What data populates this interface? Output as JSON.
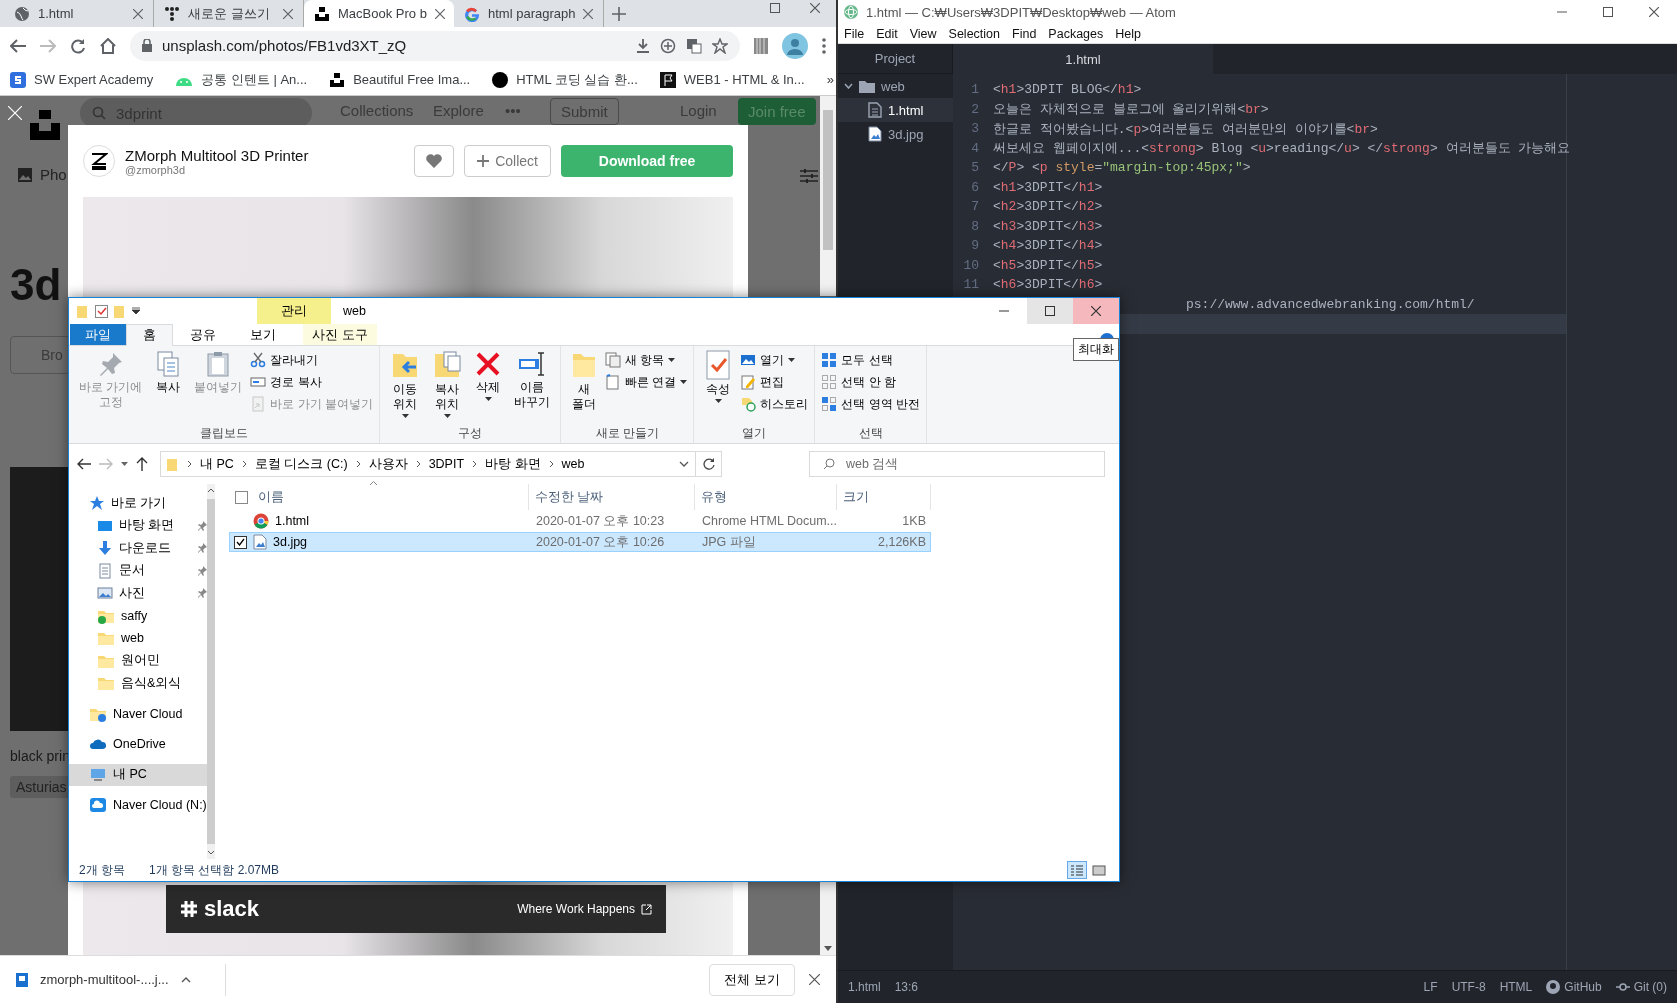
{
  "browser": {
    "tabs": [
      {
        "title": "1.html",
        "selected": false
      },
      {
        "title": "새로운 글쓰기",
        "selected": false
      },
      {
        "title": "MacBook Pro b",
        "selected": true
      },
      {
        "title": "html paragraph",
        "selected": false
      }
    ],
    "url": "unsplash.com/photos/FB1vd3XT_zQ",
    "bookmarks": [
      "SW Expert Academy",
      "공통 인텐트  |  An...",
      "Beautiful Free Ima...",
      "HTML 코딩 실습 환...",
      "WEB1 - HTML & In..."
    ],
    "more_bookmarks": "»",
    "page": {
      "search_value": "3dprint",
      "nav": [
        "Collections",
        "Explore",
        "•••"
      ],
      "submit": "Submit",
      "login": "Login",
      "join": "Join free",
      "tab": "Pho",
      "heading": "3d",
      "button": "Bro",
      "caption": "black prin",
      "tag": "Asturias",
      "modal": {
        "title": "ZMorph Multitool 3D Printer",
        "user": "@zmorph3d",
        "collect": "Collect",
        "download": "Download free"
      },
      "ad": {
        "brand": "slack",
        "link": "Where Work Happens"
      }
    },
    "download": {
      "file": "zmorph-multitool-....j...",
      "show_all": "전체 보기"
    }
  },
  "atom": {
    "title": "1.html — C:₩Users₩3DPIT₩Desktop₩web — Atom",
    "menu": [
      "File",
      "Edit",
      "View",
      "Selection",
      "Find",
      "Packages",
      "Help"
    ],
    "tree": {
      "header": "Project",
      "folder": {
        "name": "web",
        "expanded": true,
        "children": [
          {
            "name": "1.html",
            "selected": true
          },
          {
            "name": "3d.jpg",
            "selected": false
          }
        ]
      }
    },
    "tab": "1.html",
    "lines": [
      {
        "number": "1",
        "current": false,
        "tokens": [
          {
            "kind": "p",
            "text": "<"
          },
          {
            "kind": "tag",
            "text": "h1"
          },
          {
            "kind": "p",
            "text": ">3DPIT BLOG</"
          },
          {
            "kind": "tag",
            "text": "h1"
          },
          {
            "kind": "p",
            "text": ">"
          }
        ]
      },
      {
        "number": "2",
        "current": false,
        "tokens": [
          {
            "kind": "p",
            "text": "오늘은 자체적으로 블로그에 올리기위해<"
          },
          {
            "kind": "tag",
            "text": "br"
          },
          {
            "kind": "p",
            "text": ">"
          }
        ]
      },
      {
        "number": "3",
        "current": false,
        "tokens": [
          {
            "kind": "p",
            "text": "한글로 적어봤습니다.<"
          },
          {
            "kind": "tag",
            "text": "p"
          },
          {
            "kind": "p",
            "text": ">여러분들도 여러분만의 이야기를<"
          },
          {
            "kind": "tag",
            "text": "br"
          },
          {
            "kind": "p",
            "text": ">"
          }
        ]
      },
      {
        "number": "4",
        "current": false,
        "tokens": [
          {
            "kind": "p",
            "text": "써보세요 웹페이지에...<"
          },
          {
            "kind": "tag",
            "text": "strong"
          },
          {
            "kind": "p",
            "text": "> Blog <"
          },
          {
            "kind": "tag",
            "text": "u"
          },
          {
            "kind": "p",
            "text": ">reading</"
          },
          {
            "kind": "tag",
            "text": "u"
          },
          {
            "kind": "p",
            "text": "> </"
          },
          {
            "kind": "tag",
            "text": "strong"
          },
          {
            "kind": "p",
            "text": "> 여러분들도 가능해요"
          }
        ]
      },
      {
        "number": "5",
        "current": false,
        "tokens": [
          {
            "kind": "p",
            "text": "</"
          },
          {
            "kind": "tag",
            "text": "P"
          },
          {
            "kind": "p",
            "text": "> <"
          },
          {
            "kind": "tag",
            "text": "p"
          },
          {
            "kind": "attr",
            "text": " style"
          },
          {
            "kind": "p",
            "text": "="
          },
          {
            "kind": "str",
            "text": "\"margin-top:45px;\""
          },
          {
            "kind": "p",
            "text": ">"
          }
        ]
      },
      {
        "number": "6",
        "current": false,
        "tokens": [
          {
            "kind": "p",
            "text": "<"
          },
          {
            "kind": "tag",
            "text": "h1"
          },
          {
            "kind": "p",
            "text": ">3DPIT</"
          },
          {
            "kind": "tag",
            "text": "h1"
          },
          {
            "kind": "p",
            "text": ">"
          }
        ]
      },
      {
        "number": "7",
        "current": false,
        "tokens": [
          {
            "kind": "p",
            "text": "<"
          },
          {
            "kind": "tag",
            "text": "h2"
          },
          {
            "kind": "p",
            "text": ">3DPIT</"
          },
          {
            "kind": "tag",
            "text": "h2"
          },
          {
            "kind": "p",
            "text": ">"
          }
        ]
      },
      {
        "number": "8",
        "current": false,
        "tokens": [
          {
            "kind": "p",
            "text": "<"
          },
          {
            "kind": "tag",
            "text": "h3"
          },
          {
            "kind": "p",
            "text": ">3DPIT</"
          },
          {
            "kind": "tag",
            "text": "h3"
          },
          {
            "kind": "p",
            "text": ">"
          }
        ]
      },
      {
        "number": "9",
        "current": false,
        "tokens": [
          {
            "kind": "p",
            "text": "<"
          },
          {
            "kind": "tag",
            "text": "h4"
          },
          {
            "kind": "p",
            "text": ">3DPIT</"
          },
          {
            "kind": "tag",
            "text": "h4"
          },
          {
            "kind": "p",
            "text": ">"
          }
        ]
      },
      {
        "number": "10",
        "current": false,
        "tokens": [
          {
            "kind": "p",
            "text": "<"
          },
          {
            "kind": "tag",
            "text": "h5"
          },
          {
            "kind": "p",
            "text": ">3DPIT</"
          },
          {
            "kind": "tag",
            "text": "h5"
          },
          {
            "kind": "p",
            "text": ">"
          }
        ]
      },
      {
        "number": "11",
        "current": false,
        "tokens": [
          {
            "kind": "p",
            "text": "<"
          },
          {
            "kind": "tag",
            "text": "h6"
          },
          {
            "kind": "p",
            "text": ">3DPIT</"
          },
          {
            "kind": "tag",
            "text": "h6"
          },
          {
            "kind": "p",
            "text": ">"
          }
        ]
      },
      {
        "current": false,
        "tokens": [
          {
            "kind": "p",
            "text": "ps://www.advancedwebranking.com/html/"
          }
        ]
      },
      {
        "current": true
      }
    ],
    "status": {
      "file": "1.html",
      "cursor": "13:6",
      "right": [
        "LF",
        "UTF-8",
        "HTML",
        "GitHub",
        "Git (0)"
      ]
    }
  },
  "explorer": {
    "title": "web",
    "context_header": "관리",
    "tabs": [
      {
        "label": "파일",
        "kind": "file",
        "selected": false
      },
      {
        "label": "홈",
        "kind": "tab",
        "selected": true
      },
      {
        "label": "공유",
        "kind": "tab",
        "selected": false
      },
      {
        "label": "보기",
        "kind": "tab",
        "selected": false
      },
      {
        "label": "사진 도구",
        "kind": "context",
        "selected": false
      }
    ],
    "ribbon": [
      {
        "label": "클립보드",
        "items": [
          {
            "kind": "large",
            "label": "바로 가기에\n고정",
            "disabled": true,
            "dropdown": false
          },
          {
            "kind": "large",
            "label": "복사",
            "disabled": false,
            "dropdown": false
          },
          {
            "kind": "large",
            "label": "붙여넣기",
            "disabled": true,
            "dropdown": false
          },
          {
            "kind": "small",
            "label": "잘라내기",
            "disabled": false,
            "dropdown": false
          },
          {
            "kind": "small",
            "label": "경로 복사",
            "disabled": false,
            "dropdown": false
          },
          {
            "kind": "small",
            "label": "바로 가기 붙여넣기",
            "disabled": true,
            "dropdown": false
          }
        ]
      },
      {
        "label": "구성",
        "items": [
          {
            "kind": "large",
            "label": "이동\n위치",
            "disabled": false,
            "dropdown": true
          },
          {
            "kind": "large",
            "label": "복사\n위치",
            "disabled": false,
            "dropdown": true
          },
          {
            "kind": "large",
            "label": "삭제",
            "disabled": false,
            "dropdown": true
          },
          {
            "kind": "large",
            "label": "이름\n바꾸기",
            "disabled": false,
            "dropdown": false
          }
        ]
      },
      {
        "label": "새로 만들기",
        "items": [
          {
            "kind": "large",
            "label": "새\n폴더",
            "disabled": false,
            "dropdown": false
          },
          {
            "kind": "small",
            "label": "새 항목",
            "disabled": false,
            "dropdown": true
          },
          {
            "kind": "small",
            "label": "빠른 연결",
            "disabled": false,
            "dropdown": true
          }
        ]
      },
      {
        "label": "열기",
        "items": [
          {
            "kind": "large",
            "label": "속성",
            "disabled": false,
            "dropdown": true
          },
          {
            "kind": "small",
            "label": "열기",
            "disabled": false,
            "dropdown": true
          },
          {
            "kind": "small",
            "label": "편집",
            "disabled": false,
            "dropdown": false
          },
          {
            "kind": "small",
            "label": "히스토리",
            "disabled": false,
            "dropdown": false
          }
        ]
      },
      {
        "label": "선택",
        "items": [
          {
            "kind": "small",
            "label": "모두 선택",
            "disabled": false,
            "dropdown": false
          },
          {
            "kind": "small",
            "label": "선택 안 함",
            "disabled": false,
            "dropdown": false
          },
          {
            "kind": "small",
            "label": "선택 영역 반전",
            "disabled": false,
            "dropdown": false
          }
        ]
      }
    ],
    "path": [
      "내 PC",
      "로컬 디스크 (C:)",
      "사용자",
      "3DPIT",
      "바탕 화면",
      "web"
    ],
    "search": {
      "placeholder": "web 검색"
    },
    "nav": [
      {
        "label": "바로 가기",
        "selected": false,
        "children": [
          {
            "label": "바탕 화면",
            "pinned": true,
            "selected": false
          },
          {
            "label": "다운로드",
            "pinned": true,
            "selected": false
          },
          {
            "label": "문서",
            "pinned": true,
            "selected": false
          },
          {
            "label": "사진",
            "pinned": true,
            "selected": false
          },
          {
            "label": "saffy",
            "pinned": false,
            "selected": false
          },
          {
            "label": "web",
            "pinned": false,
            "selected": false
          },
          {
            "label": "원어민",
            "pinned": false,
            "selected": false
          },
          {
            "label": "음식&외식",
            "pinned": false,
            "selected": false
          }
        ]
      },
      {
        "label": "Naver Cloud",
        "selected": false
      },
      {
        "label": "OneDrive",
        "selected": false
      },
      {
        "label": "내 PC",
        "selected": true
      },
      {
        "label": "Naver Cloud (N:)",
        "selected": false
      }
    ],
    "select_all": {
      "checked": false
    },
    "columns": [
      "이름",
      "수정한 날짜",
      "유형",
      "크기"
    ],
    "rows": [
      {
        "cells": [
          "1.html",
          "2020-01-07 오후 10:23",
          "Chrome HTML Docum...",
          "1KB"
        ],
        "selected": false,
        "checked": false
      },
      {
        "cells": [
          "3d.jpg",
          "2020-01-07 오후 10:26",
          "JPG 파일",
          "2,126KB"
        ],
        "selected": true,
        "checked": true
      }
    ],
    "status": [
      "2개 항목",
      "1개 항목 선택함 2.07MB"
    ],
    "views": [
      {
        "kind": "details",
        "selected": true
      },
      {
        "kind": "tiles",
        "selected": false
      }
    ],
    "tooltip": "최대화"
  }
}
